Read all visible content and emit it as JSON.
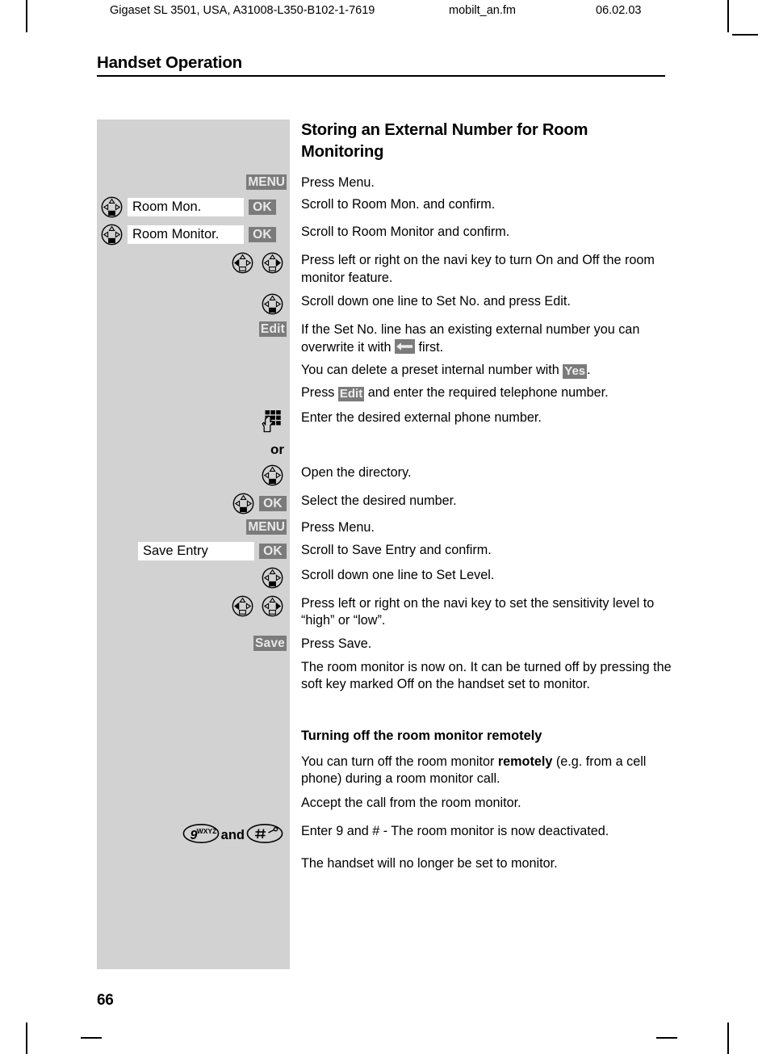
{
  "running_head": {
    "left": "Gigaset SL 3501, USA, A31008-L350-B102-1-7619",
    "center": "mobilt_an.fm",
    "right": "06.02.03"
  },
  "chapter": {
    "title": "Handset Operation"
  },
  "page_number": "66",
  "section": {
    "heading": "Storing an External Number for Room Monitoring",
    "subheading": "Turning off the room monitor remotely"
  },
  "labels": {
    "menu": "MENU",
    "ok": "OK",
    "edit": "Edit",
    "save": "Save",
    "yes": "Yes",
    "or": "or",
    "and": "and",
    "key9_digit": "9",
    "key9_letters": "WXYZ",
    "key_hash": "#"
  },
  "menu_lines": {
    "room_mon": "Room Mon.",
    "room_monitor": "Room Monitor.",
    "save_entry": "Save Entry"
  },
  "steps": [
    {
      "id": "press-menu",
      "text": "Press Menu."
    },
    {
      "id": "scroll-room-mon",
      "text": "Scroll to Room Mon. and confirm."
    },
    {
      "id": "scroll-room-monitor",
      "text": "Scroll to Room Monitor and confirm."
    },
    {
      "id": "toggle-on-off",
      "text": "Press left or right on the navi key to turn On and Off the room monitor feature."
    },
    {
      "id": "scroll-set-no",
      "text": "Scroll down one line to Set No. and press Edit."
    },
    {
      "id": "overwrite-prefix",
      "text": "If the Set No. line has an existing external number you can overwrite it with ",
      "text_suffix": " first."
    },
    {
      "id": "delete-internal-prefix",
      "text": "You can delete a preset internal number with ",
      "text_suffix": "."
    },
    {
      "id": "press-edit-prefix",
      "text": "Press ",
      "text_suffix": " and enter the required telephone number."
    },
    {
      "id": "enter-external",
      "text": "Enter the desired external phone number."
    },
    {
      "id": "open-directory",
      "text": "Open the directory."
    },
    {
      "id": "select-number",
      "text": "Select the desired number."
    },
    {
      "id": "press-menu-2",
      "text": "Press Menu."
    },
    {
      "id": "scroll-save-entry",
      "text": "Scroll to Save Entry and confirm."
    },
    {
      "id": "scroll-set-level",
      "text": "Scroll down one line to Set Level."
    },
    {
      "id": "set-sensitivity",
      "text": "Press left or right on the navi key to set the sensitivity level to “high” or “low”."
    },
    {
      "id": "press-save",
      "text": "Press Save."
    },
    {
      "id": "monitor-on",
      "text": "The room monitor is now on. It can be turned off by pressing the soft key marked Off on the handset set to monitor."
    }
  ],
  "remote_section": {
    "intro_a": "You can turn off the room monitor ",
    "intro_bold": "remotely",
    "intro_b": " (e.g. from a cell phone) during a room monitor call.",
    "accept": "Accept the call from the room monitor.",
    "enter9hash": "Enter 9 and # - The room monitor is now deactivated.",
    "no_longer": "The handset will no longer be set to monitor."
  },
  "colors": {
    "rail_gray": "#d2d2d2",
    "chip_gray": "#7b7b7b",
    "chip_text": "#e9e9e9",
    "text": "#000000"
  }
}
